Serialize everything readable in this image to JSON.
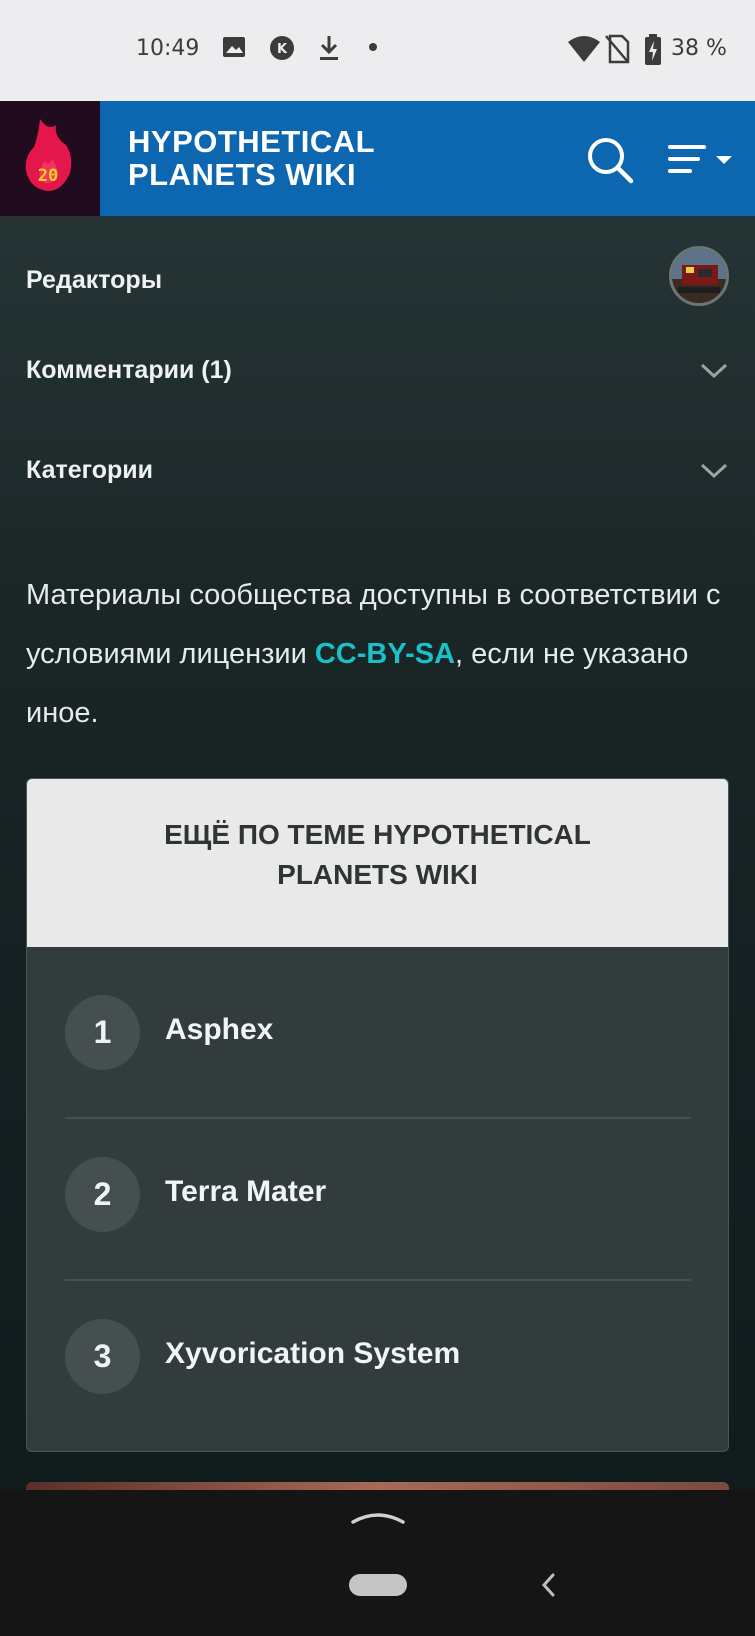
{
  "status_bar": {
    "time": "10:49",
    "battery": "38 %",
    "icons": [
      "image-icon",
      "kodi-icon",
      "download-icon",
      "dot-icon",
      "wifi-icon",
      "no-sim-icon",
      "battery-icon"
    ]
  },
  "header": {
    "logo_text": "20",
    "title": "HYPOTHETICAL PLANETS WIKI",
    "accent": "#0d67b0"
  },
  "rows": {
    "editors": "Редакторы",
    "comments": "Комментарии (1)",
    "categories": "Категории"
  },
  "license": {
    "text_before": "Материалы сообщества доступны в соответствии с условиями лицензии ",
    "link": "CC-BY-SA",
    "text_after": ", если не указано иное."
  },
  "more": {
    "heading": "ЕЩЁ ПО ТЕМЕ HYPOTHETICAL PLANETS WIKI",
    "items": [
      {
        "num": "1",
        "title": "Asphex"
      },
      {
        "num": "2",
        "title": "Terra Mater"
      },
      {
        "num": "3",
        "title": "Xyvorication System"
      }
    ]
  }
}
